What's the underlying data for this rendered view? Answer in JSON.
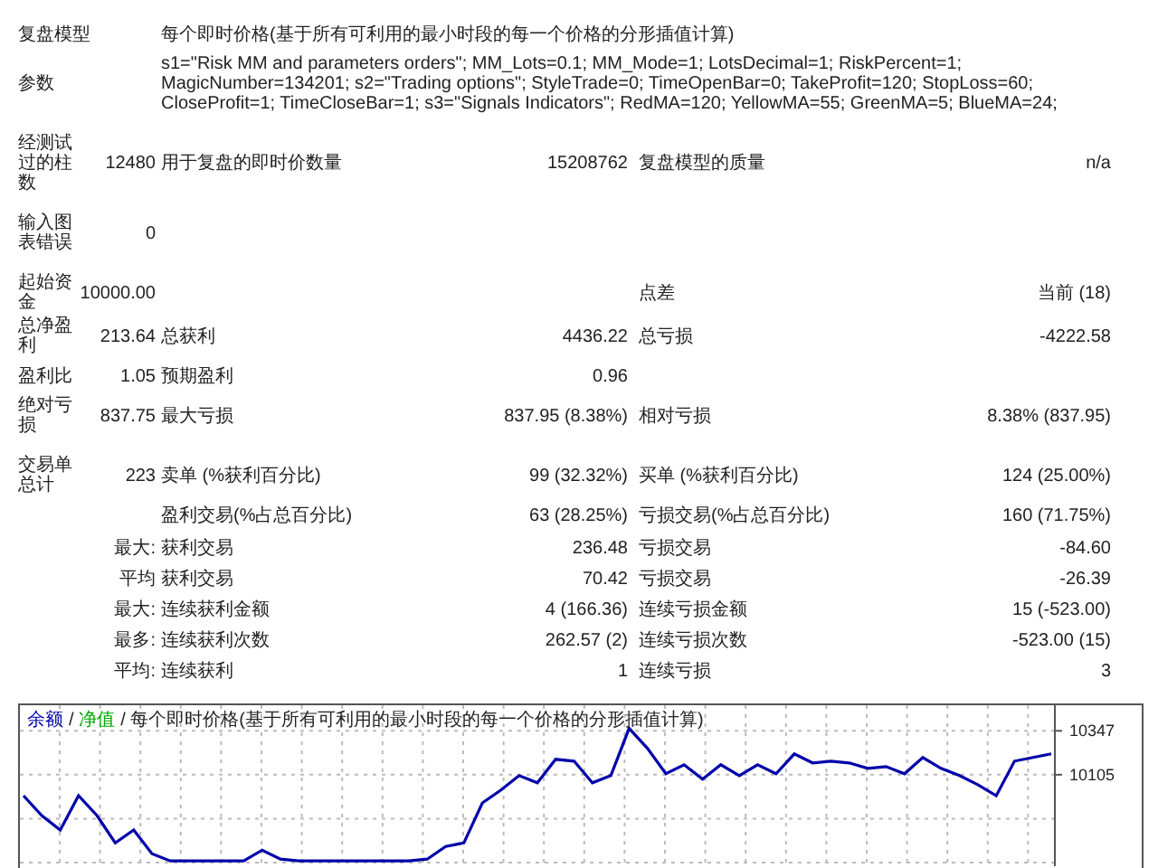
{
  "report": {
    "groups": [
      [
        {
          "kind": "wide",
          "label": "复盘模型",
          "text": "每个即时价格(基于所有可利用的最小时段的每一个价格的分形插值计算)"
        },
        {
          "kind": "wide",
          "label": "参数",
          "text": "s1=\"Risk MM and parameters orders\"; MM_Lots=0.1; MM_Mode=1; LotsDecimal=1; RiskPercent=1; MagicNumber=134201; s2=\"Trading options\"; StyleTrade=0; TimeOpenBar=0; TakeProfit=120; StopLoss=60; CloseProfit=1; TimeCloseBar=1; s3=\"Signals Indicators\"; RedMA=120; YellowMA=55; GreenMA=5; BlueMA=24;"
        }
      ],
      [
        {
          "kind": "stats",
          "label": "经测试过的柱数",
          "value": "12480",
          "label_2": "用于复盘的即时价数量",
          "value_2": "15208762",
          "label_3": "复盘模型的质量",
          "value_3": "n/a"
        }
      ],
      [
        {
          "kind": "stats",
          "label": "输入图表错误",
          "value": "0"
        }
      ],
      [
        {
          "kind": "stats",
          "label": "起始资金",
          "value": "10000.00",
          "label_3": "点差",
          "value_3": "当前 (18)"
        },
        {
          "kind": "stats",
          "label": "总净盈利",
          "value": "213.64",
          "label_2": "总获利",
          "value_2": "4436.22",
          "label_3": "总亏损",
          "value_3": "-4222.58"
        },
        {
          "kind": "stats",
          "label": "盈利比",
          "value": "1.05",
          "label_2": "预期盈利",
          "value_2": "0.96"
        },
        {
          "kind": "stats",
          "label": "绝对亏损",
          "value": "837.75",
          "label_2": "最大亏损",
          "value_2": "837.95 (8.38%)",
          "label_3": "相对亏损",
          "value_3": "8.38% (837.95)"
        }
      ],
      [
        {
          "kind": "stats",
          "label": "交易单总计",
          "value": "223",
          "label_2": "卖单 (%获利百分比)",
          "value_2": "99 (32.32%)",
          "label_3": "买单 (%获利百分比)",
          "value_3": "124 (25.00%)"
        },
        {
          "kind": "stats",
          "label_2": "盈利交易(%占总百分比)",
          "value_2": "63 (28.25%)",
          "label_3": "亏损交易(%占总百分比)",
          "value_3": "160 (71.75%)"
        },
        {
          "kind": "sub",
          "prefix": "最大:",
          "label_2": "获利交易",
          "value_2": "236.48",
          "label_3": "亏损交易",
          "value_3": "-84.60"
        },
        {
          "kind": "sub",
          "prefix": "平均",
          "label_2": "获利交易",
          "value_2": "70.42",
          "label_3": "亏损交易",
          "value_3": "-26.39"
        },
        {
          "kind": "sub",
          "prefix": "最大:",
          "label_2": "连续获利金额",
          "value_2": "4 (166.36)",
          "label_3": "连续亏损金额",
          "value_3": "15 (-523.00)"
        },
        {
          "kind": "sub",
          "prefix": "最多:",
          "label_2": "连续获利次数",
          "value_2": "262.57 (2)",
          "label_3": "连续亏损次数",
          "value_3": "-523.00 (15)"
        },
        {
          "kind": "sub",
          "prefix": "平均:",
          "label_2": "连续获利",
          "value_2": "1",
          "label_3": "连续亏损",
          "value_3": "3"
        }
      ]
    ]
  },
  "chart": {
    "legend_separator": "/",
    "legend": [
      {
        "label": "净值",
        "color": "#00aa00",
        "separator": "/"
      }
    ],
    "caption": "每个即时价格(基于所有可利用的最小时段的每一个价格的分形插值计算)",
    "chart_data": {
      "type": "line",
      "grid": true,
      "ylim": [
        9621,
        10478
      ],
      "yticks": [
        10347,
        10105
      ],
      "categories": [
        null,
        null,
        null,
        null,
        null,
        null,
        null,
        null,
        null,
        null,
        null,
        null,
        null,
        null,
        null,
        null,
        null,
        null,
        null,
        null,
        null,
        null,
        null,
        null,
        null,
        null,
        null,
        null,
        null,
        null,
        null,
        null,
        null,
        null,
        null,
        null,
        null,
        null,
        null,
        null,
        null,
        null,
        null,
        null,
        null,
        null,
        null,
        null,
        null,
        null,
        null,
        null,
        null,
        null,
        null,
        null,
        null
      ],
      "series": [
        {
          "name": "余额",
          "color": "#0000aa",
          "values": [
            9990,
            9880,
            9800,
            9990,
            9880,
            9730,
            9800,
            9670,
            9630,
            9630,
            9630,
            9630,
            9630,
            9690,
            9640,
            9630,
            9630,
            9630,
            9630,
            9630,
            9630,
            9630,
            9640,
            9710,
            9730,
            9950,
            10020,
            10100,
            10060,
            10190,
            10180,
            10060,
            10100,
            10360,
            10250,
            10110,
            10160,
            10080,
            10160,
            10100,
            10160,
            10110,
            10220,
            10170,
            10180,
            10170,
            10140,
            10150,
            10110,
            10200,
            10140,
            10100,
            10050,
            9990,
            10180,
            10200,
            10220
          ]
        }
      ]
    }
  }
}
